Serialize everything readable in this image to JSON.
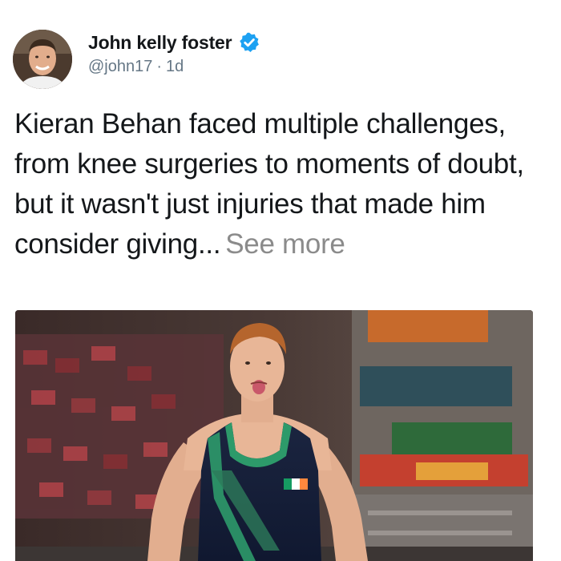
{
  "author": {
    "display_name": "John kelly foster",
    "handle": "@john17",
    "time": "1d",
    "separator": "·",
    "verified": true,
    "avatar_icon": "person-avatar"
  },
  "tweet": {
    "text": "Kieran Behan faced multiple challenges, from knee surgeries to moments of doubt, but it wasn't just injuries that made him consider giving...",
    "see_more_label": "See more"
  },
  "media": {
    "kind": "photo",
    "subject": "gymnast in dark singlet with Irish flag patch"
  },
  "colors": {
    "text_primary": "#14171a",
    "text_secondary": "#657786",
    "see_more": "#8b8b8b",
    "verified_badge": "#1da1f2"
  }
}
